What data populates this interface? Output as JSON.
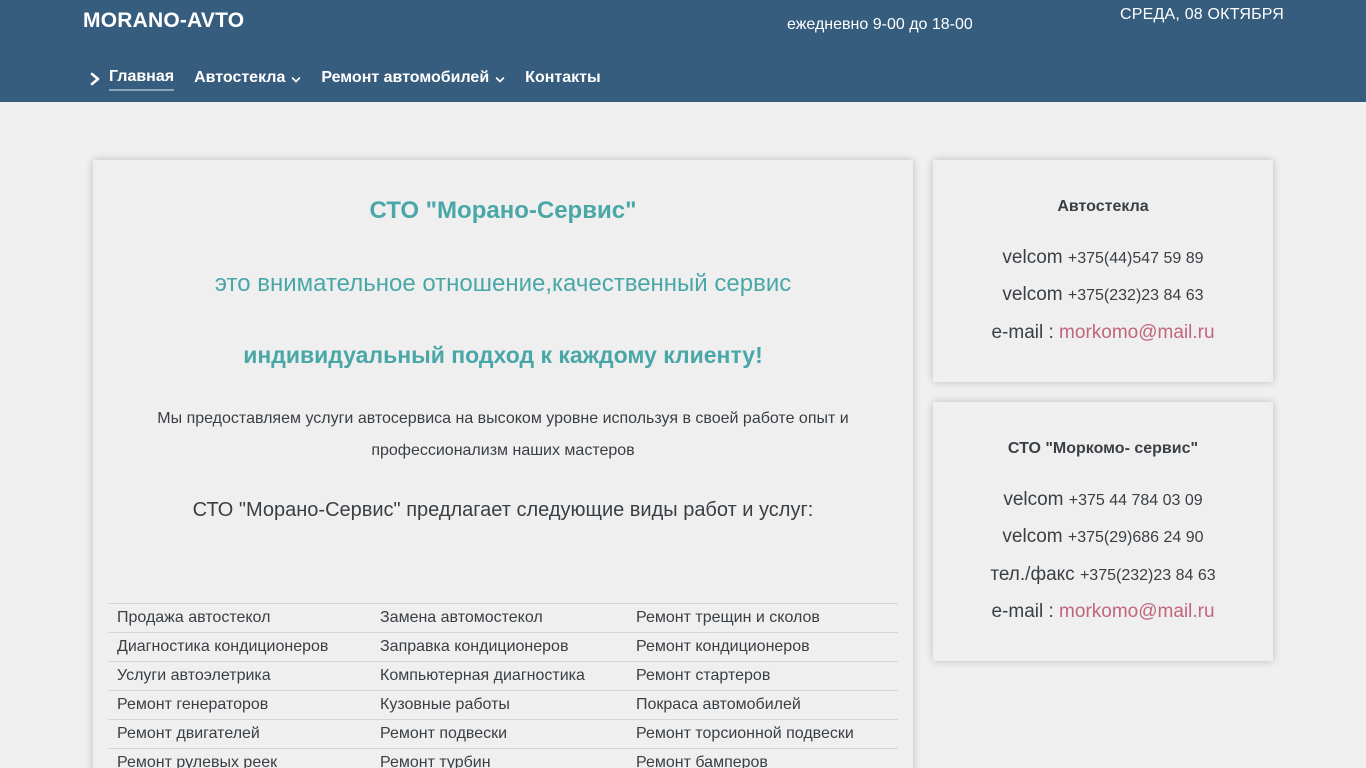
{
  "header": {
    "site_title": "MORANO-AVTO",
    "hours": "ежедневно 9-00 до 18-00",
    "date": "СРЕДА, 08 ОКТЯБРЯ",
    "nav": {
      "home": "Главная",
      "glass": "Автостекла",
      "repair": "Ремонт автомобилей",
      "contacts": "Контакты"
    }
  },
  "main": {
    "heading1": "СТО \"Морано-Сервис\"",
    "heading2": "это внимательное отношение,качественный сервис",
    "heading3": "индивидуальный подход к каждому клиенту!",
    "intro": "Мы предоставляем услуги автосервиса на высоком уровне используя в своей работе опыт и профессионализм наших мастеров",
    "offer": "СТО \"Морано-Сервис\" предлагает следующие виды работ и услуг:",
    "services": [
      [
        "Продажа автостекол",
        "Замена автомостекол",
        "Ремонт трещин и сколов"
      ],
      [
        "Диагностика кондиционеров",
        "Заправка кондиционеров",
        "Ремонт кондиционеров"
      ],
      [
        "Услуги автоэлетрика",
        "Компьютерная диагностика",
        "Ремонт стартеров"
      ],
      [
        "Ремонт генераторов",
        "Кузовные работы",
        "Покраса автомобилей"
      ],
      [
        "Ремонт двигателей",
        "Ремонт подвески",
        "Ремонт торсионной подвески"
      ],
      [
        "Ремонт рулевых реек",
        "Ремонт турбин",
        "Ремонт бамперов"
      ]
    ]
  },
  "sidebar": {
    "card1": {
      "title": "Автостекла",
      "phone1_label": "velcom",
      "phone1": "+375(44)547 59 89",
      "phone2_label": "velcom",
      "phone2": "+375(232)23 84 63",
      "email_label": "e-mail :",
      "email": "morkomo@mail.ru"
    },
    "card2": {
      "title": "СТО \"Моркомо- сервис\"",
      "phone1_label": "velcom",
      "phone1": "+375 44 784 03 09",
      "phone2_label": "velcom",
      "phone2": "+375(29)686 24 90",
      "fax_label": "тел./факс",
      "fax": "+375(232)23 84 63",
      "email_label": "e-mail :",
      "email": "morkomo@mail.ru"
    }
  },
  "colors": {
    "header_bg": "#365d7e",
    "accent_teal": "#4aa7a8",
    "link_pink": "#c0667e",
    "page_bg": "#f0f0f0"
  },
  "icons": {
    "nav_active": "chevron-right-icon",
    "dropdown": "chevron-down-icon"
  }
}
